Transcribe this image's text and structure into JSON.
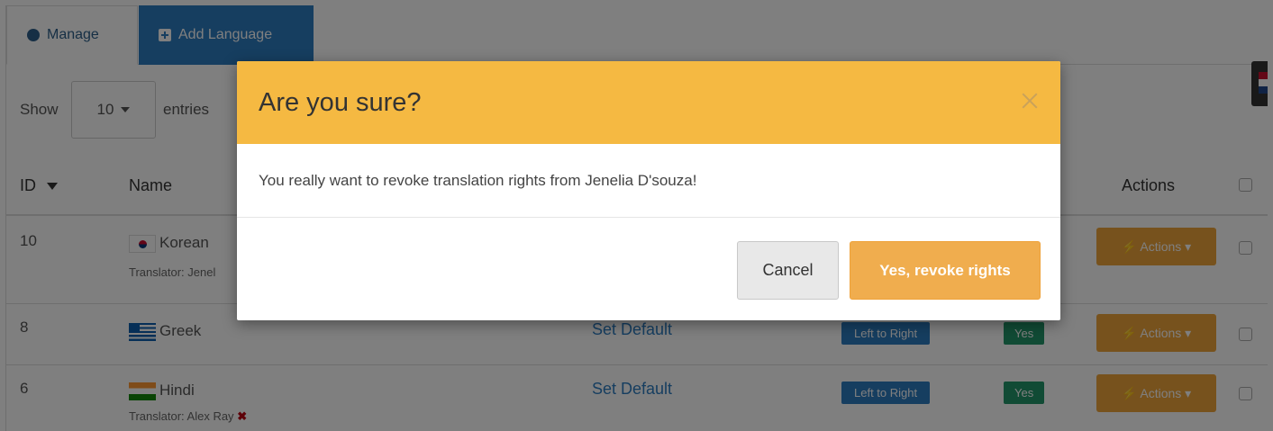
{
  "tabs": {
    "manage_label": "Manage",
    "add_label": "Add Language"
  },
  "length": {
    "show_label": "Show",
    "value": "10",
    "entries_label": "entries"
  },
  "table": {
    "headers": {
      "id": "ID",
      "name": "Name",
      "actions": "Actions"
    },
    "rows": [
      {
        "id": "10",
        "name": "Korean",
        "translator": "Translator: Jenel",
        "action_label": "Actions"
      },
      {
        "id": "8",
        "name": "Greek",
        "set_default": "Set Default",
        "direction": "Left to Right",
        "active": "Yes",
        "action_label": "Actions"
      },
      {
        "id": "6",
        "name": "Hindi",
        "translator": "Translator: Alex Ray",
        "set_default": "Set Default",
        "direction": "Left to Right",
        "active": "Yes",
        "action_label": "Actions"
      }
    ]
  },
  "modal": {
    "title": "Are you sure?",
    "message": "You really want to revoke translation rights from Jenelia D'souza!",
    "cancel_label": "Cancel",
    "confirm_label": "Yes, revoke rights"
  },
  "colors": {
    "modal_header": "#f5b942",
    "confirm_button": "#f0ad4e",
    "primary_blue": "#2d7cc1",
    "success_green": "#23976b"
  }
}
